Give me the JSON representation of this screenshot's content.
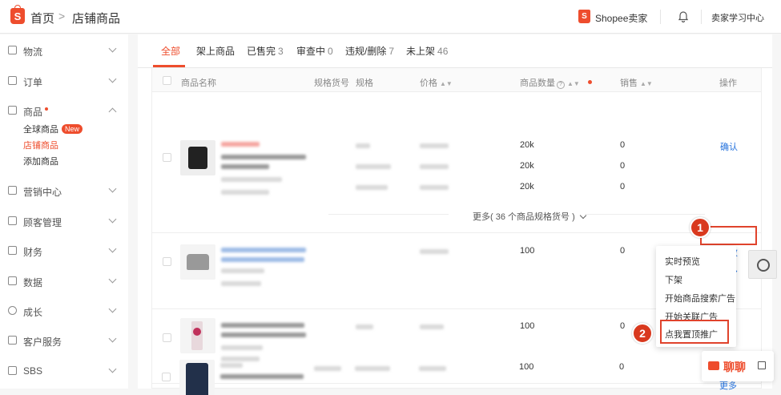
{
  "header": {
    "home": "首页",
    "separator": ">",
    "current": "店铺商品",
    "brand": "Shopee卖家",
    "learning_center": "卖家学习中心",
    "logo_letter": "S"
  },
  "sidebar": {
    "items": [
      {
        "label": "物流",
        "icon": "truck-icon"
      },
      {
        "label": "订单",
        "icon": "clipboard-icon"
      },
      {
        "label": "商品",
        "icon": "box-icon",
        "expanded": true
      },
      {
        "label": "营销中心",
        "icon": "tag-icon"
      },
      {
        "label": "顾客管理",
        "icon": "user-icon"
      },
      {
        "label": "财务",
        "icon": "wallet-icon"
      },
      {
        "label": "数据",
        "icon": "chart-icon"
      },
      {
        "label": "成长",
        "icon": "medal-icon"
      },
      {
        "label": "客户服务",
        "icon": "headset-icon"
      },
      {
        "label": "SBS",
        "icon": "warehouse-icon"
      }
    ],
    "subitems": [
      {
        "label": "全球商品",
        "tag": "New"
      },
      {
        "label": "店铺商品",
        "active": true
      },
      {
        "label": "添加商品"
      }
    ]
  },
  "tabs": [
    {
      "label": "全部",
      "count": "",
      "active": true
    },
    {
      "label": "架上商品",
      "count": ""
    },
    {
      "label": "已售完",
      "count": "3"
    },
    {
      "label": "审查中",
      "count": "0"
    },
    {
      "label": "违规/删除",
      "count": "7"
    },
    {
      "label": "未上架",
      "count": "46"
    }
  ],
  "table": {
    "columns": [
      "商品名称",
      "规格货号",
      "规格",
      "价格",
      "商品数量",
      "销售",
      "操作"
    ],
    "rows": [
      {
        "quantities": [
          "20k",
          "20k",
          "20k"
        ],
        "sales": [
          "0",
          "0",
          "0"
        ],
        "actions": [
          "确认"
        ]
      },
      {
        "quantities": [
          "100"
        ],
        "sales": [
          "0"
        ],
        "actions": [
          "修改",
          "更多"
        ]
      },
      {
        "quantities": [
          "100"
        ],
        "sales": [
          "0"
        ],
        "actions": []
      },
      {
        "quantities": [
          "100"
        ],
        "sales": [
          "0"
        ],
        "actions": [
          "更多"
        ]
      }
    ],
    "more_variants": "更多( 36 个商品规格货号 )"
  },
  "dropdown": {
    "items": [
      "实时预览",
      "下架",
      "开始商品搜索广告",
      "开始关联广告",
      "点我置顶推广"
    ]
  },
  "annotations": {
    "step1": "1",
    "step2": "2"
  },
  "chat": {
    "label": "聊聊"
  },
  "colors": {
    "accent": "#ee4d2d",
    "link": "#2673dd",
    "callout": "#e0432c"
  }
}
